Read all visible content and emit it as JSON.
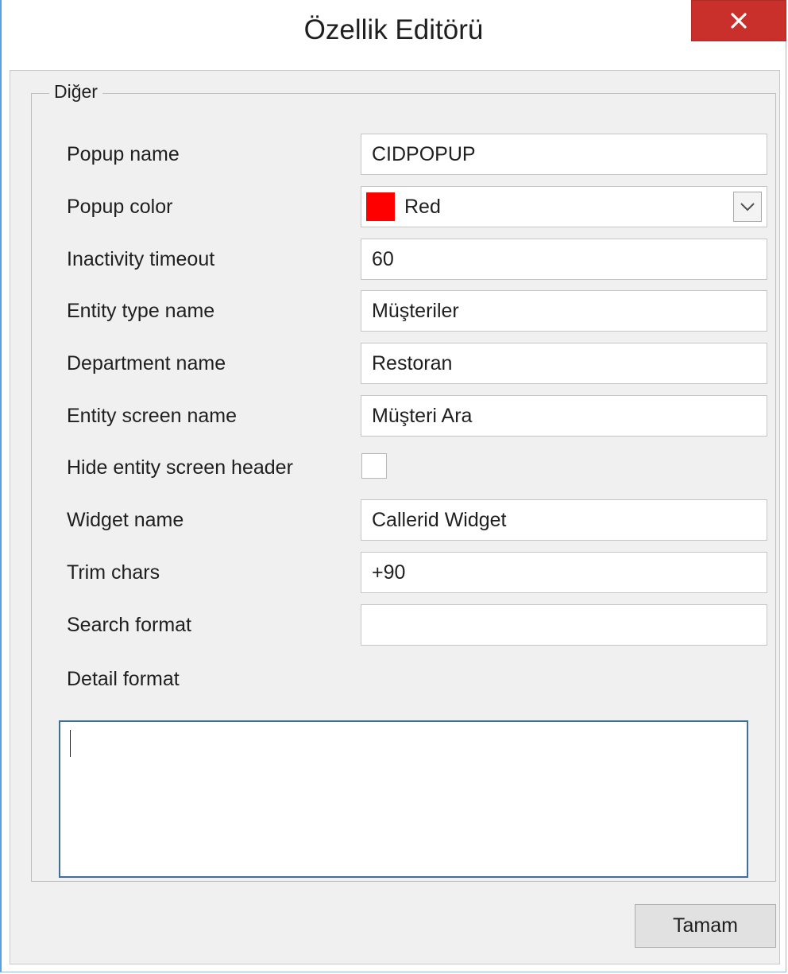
{
  "window": {
    "title": "Özellik Editörü",
    "close_glyph": "✕"
  },
  "group": {
    "legend": "Diğer"
  },
  "fields": {
    "popup_name": {
      "label": "Popup name",
      "value": "CIDPOPUP"
    },
    "popup_color": {
      "label": "Popup color",
      "value": "Red",
      "swatch_color": "#ff0000"
    },
    "inactivity_timeout": {
      "label": "Inactivity timeout",
      "value": "60"
    },
    "entity_type_name": {
      "label": "Entity type name",
      "value": "Müşteriler"
    },
    "department_name": {
      "label": "Department name",
      "value": "Restoran"
    },
    "entity_screen_name": {
      "label": "Entity screen name",
      "value": "Müşteri Ara"
    },
    "hide_entity_screen_header": {
      "label": "Hide entity screen header",
      "checked": false
    },
    "widget_name": {
      "label": "Widget name",
      "value": "Callerid Widget"
    },
    "trim_chars": {
      "label": "Trim chars",
      "value": "+90"
    },
    "search_format": {
      "label": "Search format",
      "value": ""
    },
    "detail_format": {
      "label": "Detail format",
      "value": ""
    }
  },
  "buttons": {
    "ok_label": "Tamam"
  },
  "colors": {
    "close_bg": "#c9302c",
    "accent_border": "#3f6e9e"
  }
}
